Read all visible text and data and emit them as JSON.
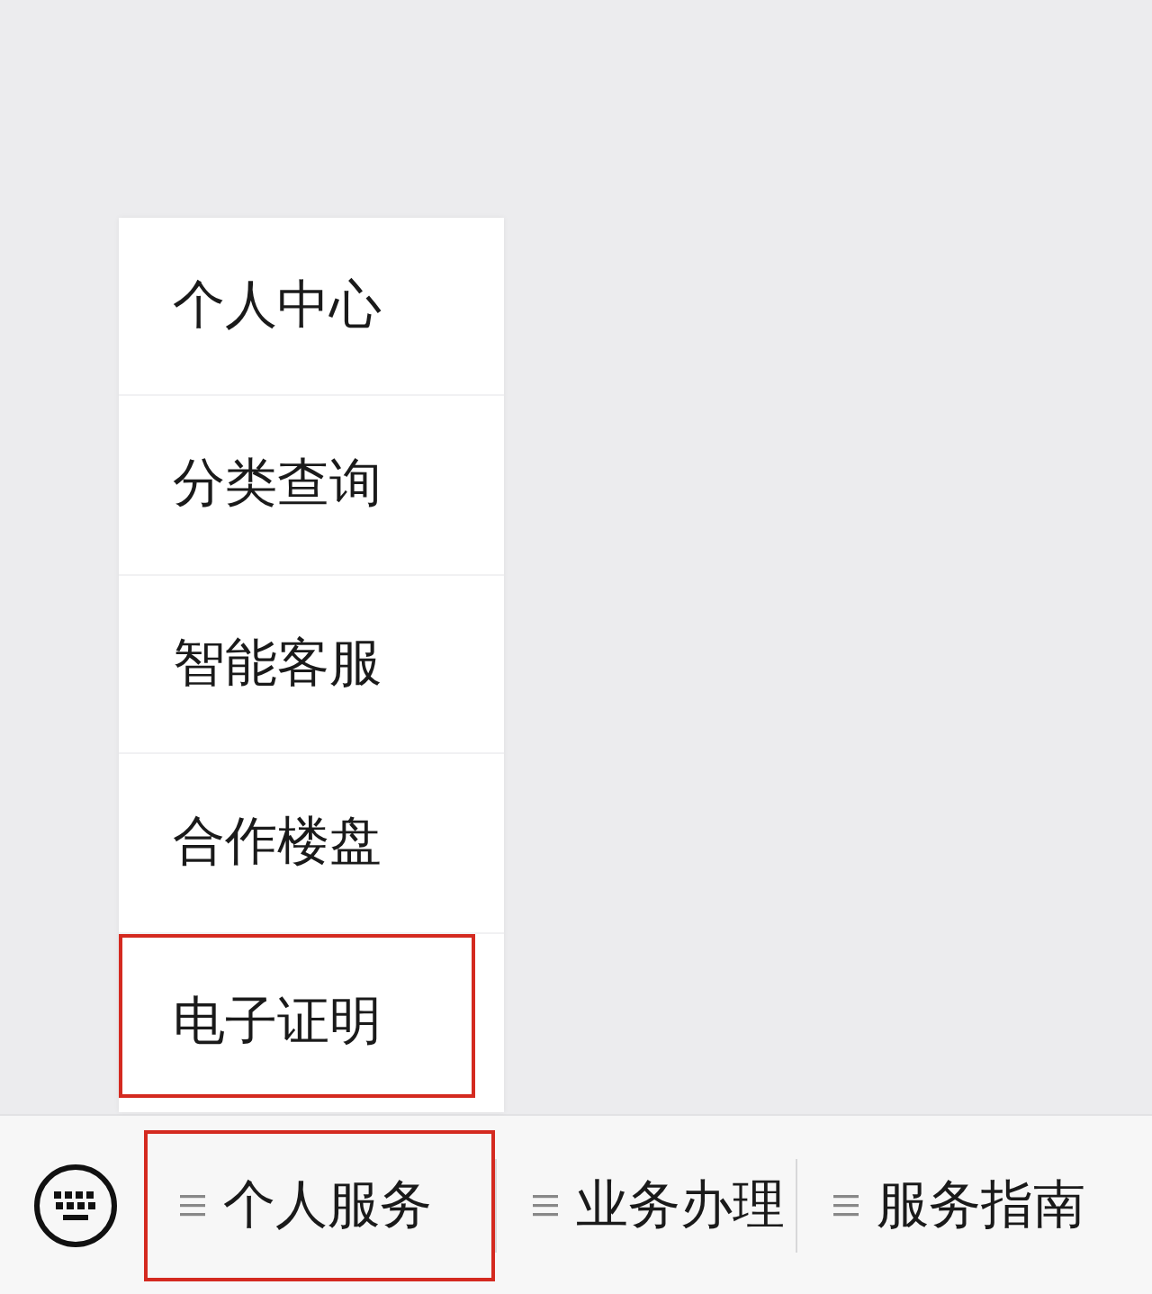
{
  "menu": {
    "items": [
      {
        "label": "个人中心",
        "highlighted": false
      },
      {
        "label": "分类查询",
        "highlighted": false
      },
      {
        "label": "智能客服",
        "highlighted": false
      },
      {
        "label": "合作楼盘",
        "highlighted": false
      },
      {
        "label": "电子证明",
        "highlighted": true
      }
    ]
  },
  "bottom_bar": {
    "tabs": [
      {
        "label": "个人服务",
        "highlighted": true
      },
      {
        "label": "业务办理",
        "highlighted": false
      },
      {
        "label": "服务指南",
        "highlighted": false
      }
    ]
  }
}
